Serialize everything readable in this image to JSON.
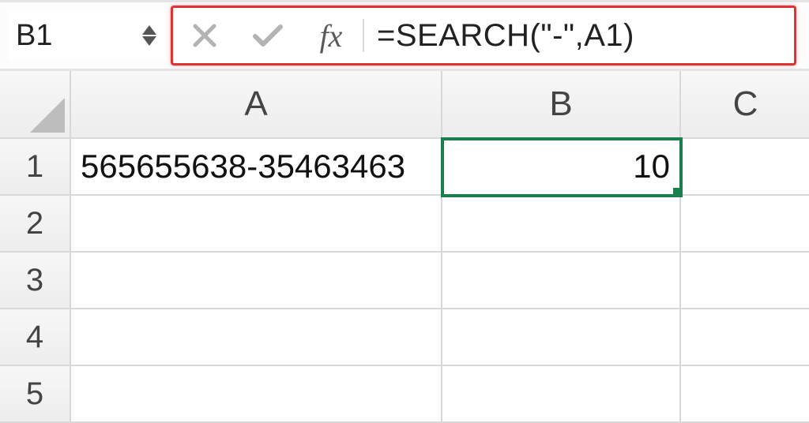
{
  "namebox": {
    "value": "B1"
  },
  "formula_bar": {
    "fx_label": "fx",
    "formula": "=SEARCH(\"-\",A1)"
  },
  "columns": [
    "A",
    "B",
    "C"
  ],
  "rows": [
    "1",
    "2",
    "3",
    "4",
    "5"
  ],
  "cells": {
    "A1": "565655638-35463463",
    "B1": "10"
  },
  "selected_cell": "B1"
}
